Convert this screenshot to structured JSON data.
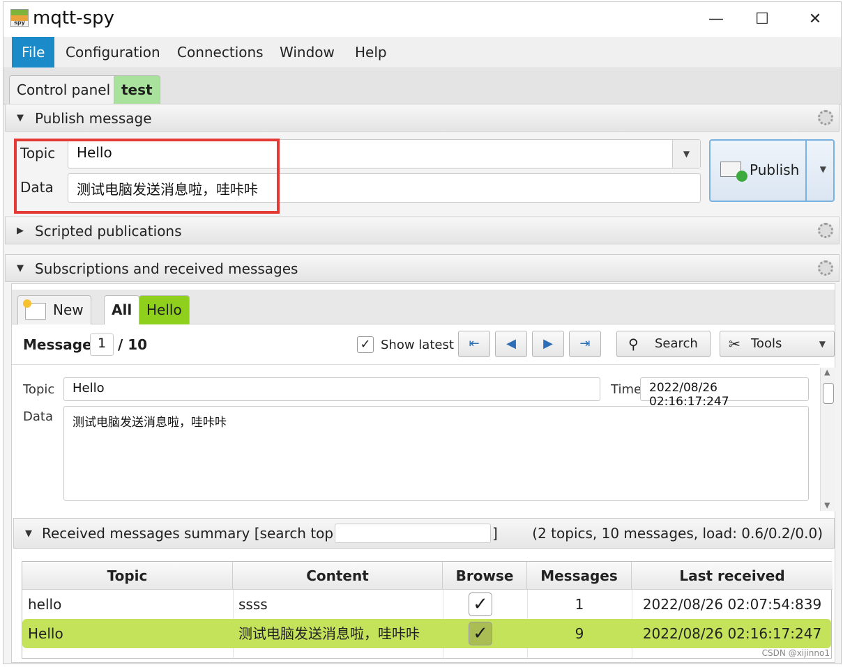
{
  "window": {
    "title": "mqtt-spy",
    "icon_text": "spy",
    "controls": {
      "minimize": "—",
      "maximize": "☐",
      "close": "✕"
    }
  },
  "menu": [
    "File",
    "Configuration",
    "Connections",
    "Window",
    "Help"
  ],
  "tabs": [
    {
      "label": "Control panel"
    },
    {
      "label": "test"
    }
  ],
  "publish": {
    "section_title": "Publish message",
    "topic_label": "Topic",
    "topic_value": "Hello",
    "data_label": "Data",
    "data_value": "测试电脑发送消息啦，哇咔咔",
    "button_label": "Publish"
  },
  "scripted": {
    "section_title": "Scripted publications"
  },
  "subscriptions": {
    "section_title": "Subscriptions and received messages",
    "new_label": "New",
    "tabs": [
      "All",
      "Hello"
    ],
    "message_label": "Message",
    "message_index": "1",
    "message_total": "/ 10",
    "show_latest_label": "Show latest",
    "nav_icons": [
      "first-icon",
      "previous-icon",
      "next-icon",
      "last-icon"
    ],
    "search_label": "Search",
    "tools_label": "Tools",
    "detail": {
      "topic_label": "Topic",
      "topic_value": "Hello",
      "time_label": "Time",
      "time_value": "2022/08/26 02:16:17:247",
      "data_label": "Data",
      "data_value": "测试电脑发送消息啦，哇咔咔"
    }
  },
  "summary": {
    "title": "Received messages summary [search topics:",
    "title_end": "]",
    "stats": "(2 topics, 10 messages, load: 0.6/0.2/0.0)",
    "columns": [
      "Topic",
      "Content",
      "Browse",
      "Messages",
      "Last received"
    ],
    "rows": [
      {
        "topic": "hello",
        "content": "ssss",
        "browse": "✓",
        "messages": "1",
        "last": "2022/08/26 02:07:54:839"
      },
      {
        "topic": "Hello",
        "content": "测试电脑发送消息啦，哇咔咔",
        "browse": "✓",
        "messages": "9",
        "last": "2022/08/26 02:16:17:247"
      }
    ]
  },
  "watermark": "CSDN @xijinno1",
  "colors": {
    "accent": "#1b8ac9",
    "tab_green": "#a9e29c",
    "hello_tab": "#8ed01c",
    "selected_row": "#c4e35a",
    "highlight_box": "#e53935"
  }
}
